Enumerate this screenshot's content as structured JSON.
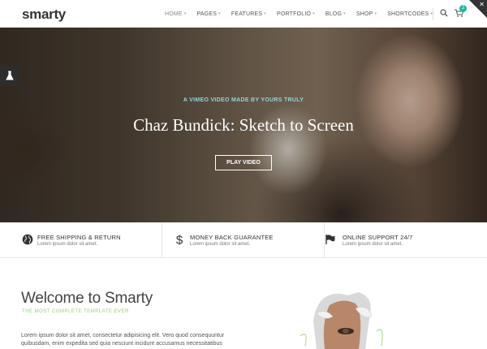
{
  "header": {
    "logo": "smarty",
    "nav": [
      "HOME",
      "PAGES",
      "FEATURES",
      "PORTFOLIO",
      "BLOG",
      "SHOP",
      "SHORTCODES"
    ],
    "cart_count": "2"
  },
  "hero": {
    "kicker": "A VIMEO VIDEO MADE BY YOURS TRULY",
    "title": "Chaz Bundick: Sketch to Screen",
    "button": "PLAY VIDEO"
  },
  "features": [
    {
      "icon": "globe-icon",
      "title": "FREE SHIPPING & RETURN",
      "desc": "Lorem ipsum dolor sit amet."
    },
    {
      "icon": "dollar-icon",
      "title": "MONEY BACK GUARANTEE",
      "desc": "Lorem ipsum dolor sit amet."
    },
    {
      "icon": "flag-icon",
      "title": "ONLINE SUPPORT 24/7",
      "desc": "Lorem ipsum dolor sit amet."
    }
  ],
  "welcome": {
    "title": "Welcome to Smarty",
    "subtitle": "THE MOST COMPLETE TEMPLATE EVER",
    "text": "Lorem ipsum dolor sit amet, consectetur adipisicing elit. Vero quod consequuntur quibusdam, enim expedita sed quia nesciunt incidunt accusamus necessitatibus"
  },
  "colors": {
    "accent": "#1abc9c",
    "kicker": "#8fd4d9",
    "subtitle": "#9acd7d"
  }
}
